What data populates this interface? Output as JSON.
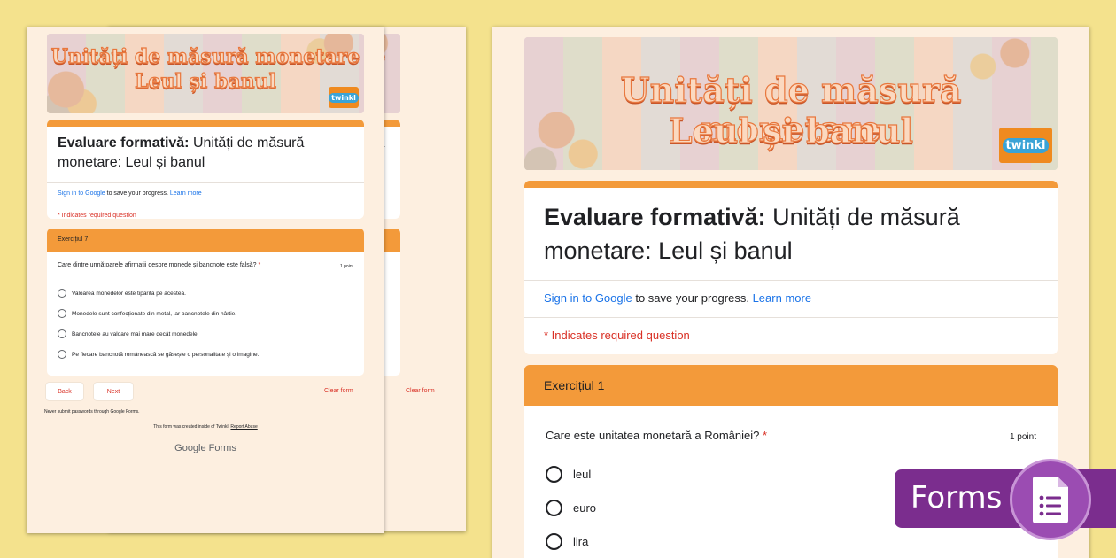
{
  "banner": {
    "line1": "Unități de măsură monetare",
    "line2": "Leul și banul",
    "logo": "twinkl"
  },
  "form": {
    "title_bold": "Evaluare formativă:",
    "title_rest": " Unități de măsură monetare: Leul și banul",
    "sign_in_link": "Sign in to Google",
    "sign_in_rest": " to save your progress. ",
    "learn_more": "Learn more",
    "required": "* Indicates required question"
  },
  "small_page": {
    "section": "Exercițiul 7",
    "question": "Care dintre următoarele afirmații despre monede și bancnote este falsă?",
    "star": " *",
    "points": "1 point",
    "options": [
      "Valoarea monedelor este tipărită pe acestea.",
      "Monedele sunt confecționate din metal, iar bancnotele din hârtie.",
      "Bancnotele au valoare mai mare decât monedele.",
      "Pe fiecare bancnotă românească se găsește o personalitate și o imagine."
    ],
    "back": "Back",
    "next": "Next",
    "clear": "Clear form",
    "footer1": "Never submit passwords through Google Forms.",
    "footer2": "This form was created inside of Twinkl.",
    "footer2_link": "Report Abuse",
    "google_forms": "Google Forms"
  },
  "big_page": {
    "section": "Exercițiul 1",
    "question": "Care este unitatea monetară a României?",
    "star": " *",
    "points": "1 point",
    "options": [
      "leul",
      "euro",
      "lira"
    ]
  },
  "badge": {
    "label": "Forms",
    "icon": "google-forms-icon"
  },
  "colors": {
    "accent": "#f39a3a",
    "background": "#f4e28d",
    "page": "#fdefe0",
    "badge": "#7b2d8e",
    "required": "#d93025",
    "link": "#1a73e8"
  }
}
